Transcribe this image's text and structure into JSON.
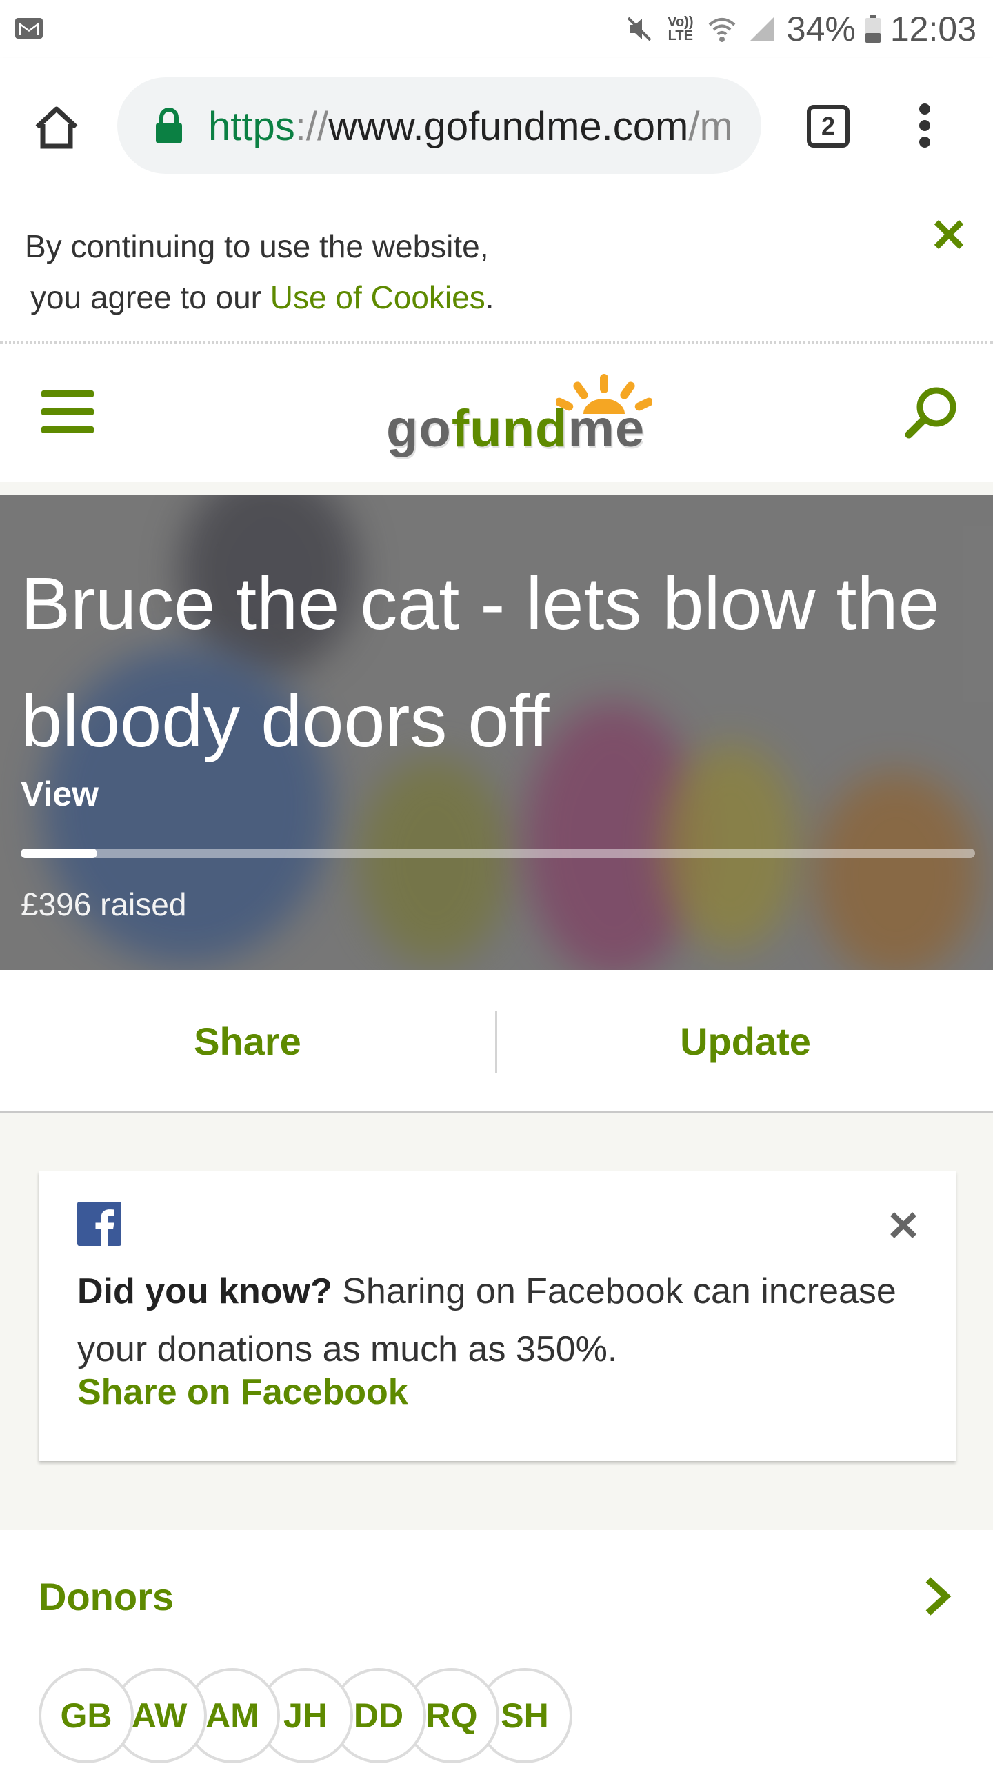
{
  "status_bar": {
    "battery": "34%",
    "time": "12:03",
    "network": "Vo)) LTE",
    "icons": [
      "gmail-icon",
      "mute-icon",
      "wifi-icon",
      "signal-icon",
      "battery-icon"
    ]
  },
  "browser": {
    "url_scheme": "https",
    "url_sep": "://",
    "url_host": "www.gofundme.com",
    "url_rest": "/m",
    "tab_count": "2",
    "icons": [
      "home-icon",
      "lock-icon",
      "tabs-icon",
      "more-vert-icon"
    ]
  },
  "cookie_banner": {
    "line1": "By continuing to use the website,",
    "line2_prefix": "you agree to our ",
    "link": "Use of Cookies",
    "line2_suffix": "."
  },
  "header": {
    "logo_go": "go",
    "logo_fund": "fund",
    "logo_me": "me",
    "accent": "#5e8a00"
  },
  "campaign": {
    "title": "Bruce the cat - lets blow the bloody doors off",
    "view_label": "View",
    "progress_fraction": 0.08,
    "raised": "£396 raised"
  },
  "actions": {
    "share": "Share",
    "update": "Update"
  },
  "facebook_card": {
    "bold": "Did you know?",
    "text": " Sharing on Facebook can increase your donations as much as 350%.",
    "link": "Share on Facebook"
  },
  "donors": {
    "title": "Donors",
    "initials": [
      "GB",
      "AW",
      "AM",
      "JH",
      "DD",
      "RQ",
      "SH"
    ]
  }
}
